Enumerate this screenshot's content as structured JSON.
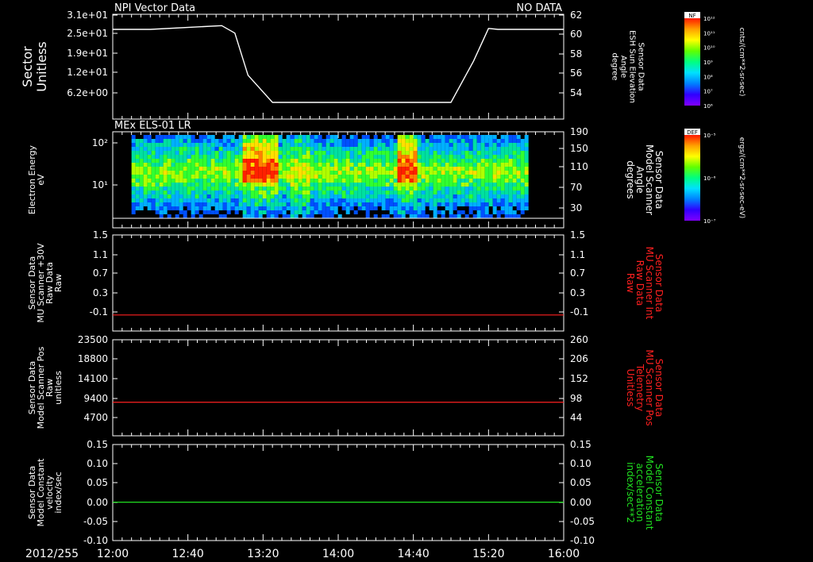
{
  "date_label": "2012/255",
  "time_ticks": [
    "12:00",
    "12:40",
    "13:20",
    "14:00",
    "14:40",
    "15:20",
    "16:00"
  ],
  "colorbars": [
    {
      "title": "NF",
      "unit": "cnts/(cm**2-sr-sec)",
      "labels": [
        "10¹²",
        "10¹¹",
        "10¹⁰",
        "10⁹",
        "10⁸",
        "10⁷",
        "10⁶"
      ]
    },
    {
      "title": "DEF",
      "unit": "ergs/(cm**2-sr-sec-eV)",
      "labels": [
        "10⁻⁵",
        "10⁻⁶",
        "10⁻⁷"
      ]
    }
  ],
  "panels": [
    {
      "title_left": "NPI Vector Data",
      "title_right": "NO DATA",
      "left_label": [
        "Sector",
        "Unitless"
      ],
      "left_ticks": [
        "3.1e+01",
        "2.5e+01",
        "1.9e+01",
        "1.2e+01",
        "6.2e+00"
      ],
      "right_label": [
        "Sensor Data",
        "ESH Sun Elevation",
        "Angle",
        "degree"
      ],
      "right_ticks": [
        "62",
        "60",
        "58",
        "56",
        "54"
      ]
    },
    {
      "title_left": "MEx ELS-01 LR",
      "title_right": "",
      "left_label": [
        "Electron Energy",
        "eV"
      ],
      "left_ticks": [
        "10²",
        "10¹"
      ],
      "right_label": [
        "Sensor Data",
        "Model Scanner",
        "Angle",
        "degrees"
      ],
      "right_ticks": [
        "190",
        "150",
        "110",
        "70",
        "30"
      ]
    },
    {
      "title_left": "",
      "title_right": "",
      "left_label": [
        "Sensor Data",
        "MU Scanner +30V",
        "Raw Data",
        "Raw"
      ],
      "left_ticks": [
        "1.5",
        "1.1",
        "0.7",
        "0.3",
        "-0.1"
      ],
      "right_label": [
        "Sensor Data",
        "MU Scanner Int",
        "Raw Data",
        "Raw"
      ],
      "right_ticks": [
        "1.5",
        "1.1",
        "0.7",
        "0.3",
        "-0.1"
      ]
    },
    {
      "title_left": "",
      "title_right": "",
      "left_label": [
        "Sensor Data",
        "Model Scanner Pos",
        "Raw",
        "unitless"
      ],
      "left_ticks": [
        "23500",
        "18800",
        "14100",
        "9400",
        "4700"
      ],
      "right_label": [
        "Sensor Data",
        "MU Scanner Pos",
        "Telemetry",
        "Unitless"
      ],
      "right_ticks": [
        "260",
        "206",
        "152",
        "98",
        "44"
      ]
    },
    {
      "title_left": "",
      "title_right": "",
      "left_label": [
        "Sensor Data",
        "Model Constant",
        "velocity",
        "index/sec"
      ],
      "left_ticks": [
        "0.15",
        "0.10",
        "0.05",
        "0.00",
        "-0.05",
        "-0.10"
      ],
      "right_label": [
        "Sensor Data",
        "Model Constant",
        "acceleration",
        "index/sec**2"
      ],
      "right_ticks": [
        "0.15",
        "0.10",
        "0.05",
        "0.00",
        "-0.05",
        "-0.10"
      ]
    }
  ],
  "colors": {
    "white": "#ffffff",
    "red": "#ff2020",
    "green": "#20e020"
  },
  "chart_data": [
    {
      "type": "line",
      "ylabel": "ESH Sun Elevation Angle (degree)",
      "ylim": [
        52,
        62
      ],
      "x": [
        "12:00",
        "12:20",
        "12:58",
        "13:05",
        "13:12",
        "13:25",
        "13:45",
        "14:00",
        "14:40",
        "15:00",
        "15:12",
        "15:20",
        "15:25",
        "16:00"
      ],
      "y": [
        60.9,
        60.9,
        61.3,
        60.5,
        56.0,
        53.1,
        53.1,
        53.1,
        53.1,
        53.1,
        57.5,
        61.0,
        60.9,
        60.9
      ]
    },
    {
      "type": "heatmap",
      "ylabel": "Electron Energy (eV)",
      "yscale": "log",
      "x_range": [
        "12:10",
        "15:40"
      ],
      "features": [
        {
          "x": [
            "13:08",
            "13:28"
          ],
          "level": "high"
        },
        {
          "x": [
            "13:34",
            "13:44"
          ],
          "level": "medium"
        },
        {
          "x": [
            "14:30",
            "14:40"
          ],
          "level": "high"
        }
      ]
    },
    {
      "type": "line",
      "ylabel": "MU Scanner +30V Raw",
      "ylim": [
        -0.3,
        1.5
      ],
      "x": [
        "12:00",
        "16:00"
      ],
      "y": [
        0.0,
        0.0
      ]
    },
    {
      "type": "line",
      "ylabel": "Model Scanner Pos Raw",
      "ylim": [
        0,
        23500
      ],
      "x": [
        "12:00",
        "16:00"
      ],
      "y": [
        8200,
        8200
      ]
    },
    {
      "type": "line",
      "ylabel": "Model Constant velocity",
      "ylim": [
        -0.1,
        0.15
      ],
      "x": [
        "12:00",
        "16:00"
      ],
      "y": [
        0.0,
        0.0
      ]
    }
  ]
}
